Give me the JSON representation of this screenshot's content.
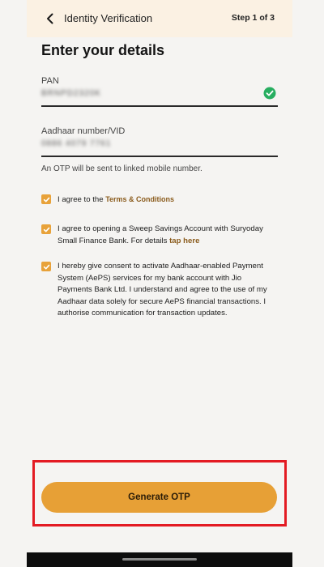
{
  "header": {
    "title": "Identity Verification",
    "step": "Step 1 of 3",
    "back_icon": "chevron-left-icon"
  },
  "page": {
    "title": "Enter your details"
  },
  "pan": {
    "label": "PAN",
    "value": "BRNPD2320K",
    "status_icon": "check-circle-icon",
    "status_color": "#27ae60"
  },
  "aadhaar": {
    "label": "Aadhaar number/VID",
    "value": "0886 4079 7761"
  },
  "otp_note": "An OTP will be sent to linked mobile number.",
  "consents": [
    {
      "checked": true,
      "text": "I agree to the ",
      "link": "Terms & Conditions"
    },
    {
      "checked": true,
      "text": "I agree to opening a Sweep Savings Account with Suryoday Small Finance Bank. For details ",
      "link": "tap here"
    },
    {
      "checked": true,
      "text": "I hereby give consent to activate Aadhaar-enabled Payment System (AePS) services for my bank account with Jio Payments Bank Ltd. I understand and agree to the use of my Aadhaar data solely for secure AePS financial transactions. I authorise communication for transaction updates.",
      "link": ""
    }
  ],
  "primary_button": {
    "label": "Generate OTP",
    "color": "#e7a036"
  },
  "colors": {
    "accent": "#e8a23a",
    "highlight_border": "#e31b23",
    "header_bg": "#fbf1e3"
  }
}
